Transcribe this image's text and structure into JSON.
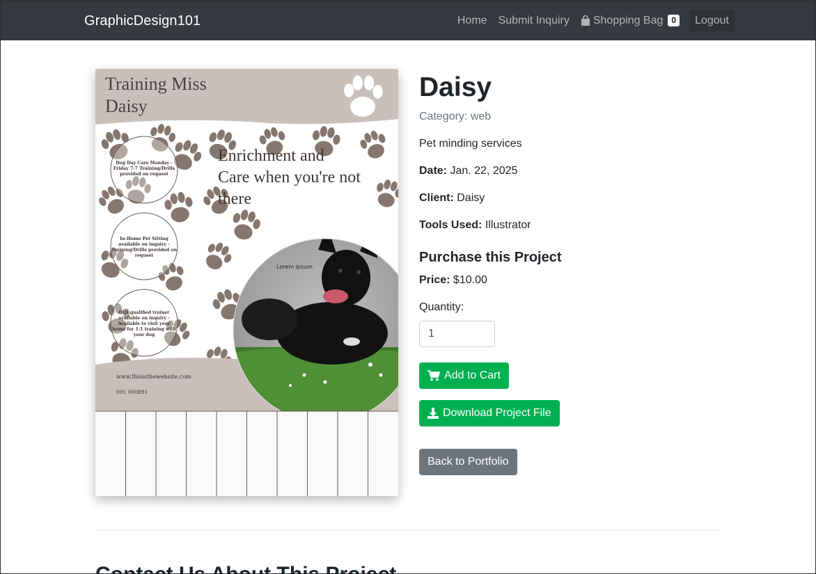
{
  "nav": {
    "brand": "GraphicDesign101",
    "links": {
      "home": "Home",
      "inquiry": "Submit Inquiry",
      "bag": "Shopping Bag",
      "bag_count": "0",
      "logout": "Logout"
    }
  },
  "poster": {
    "title_line1": "Training Miss",
    "title_line2": "Daisy",
    "headline_line1": "Enrichment and",
    "headline_line2": "Care when you're not",
    "headline_line3": "there",
    "circle1": [
      "Dog Day Care Monday -",
      "Friday 7-7 Training/Drills",
      "provided on request"
    ],
    "circle2": [
      "In-Home Pet Sitting",
      "available on inquiry -",
      "Training/Drills provided on",
      "request"
    ],
    "circle3": [
      "QQI qualified trainer",
      "available on inquiry -",
      "Available to visit your",
      "home for 1:1 training with",
      "your dog"
    ],
    "lorem": "Lorem ipsum",
    "website": "www.thisisthewebsite.com",
    "phone": "091 000891",
    "colors": {
      "band": "#c9bfbb",
      "paw": "#85766f"
    }
  },
  "project": {
    "title": "Daisy",
    "category": "Category: web",
    "description": "Pet minding services",
    "date_label": "Date:",
    "date": "Jan. 22, 2025",
    "client_label": "Client:",
    "client": "Daisy",
    "tools_label": "Tools Used:",
    "tools": "Illustrator"
  },
  "purchase": {
    "heading": "Purchase this Project",
    "price_label": "Price:",
    "price": "$10.00",
    "quantity_label": "Quantity:",
    "quantity_value": "1",
    "add_to_cart": "Add to Cart",
    "download": "Download Project File",
    "back": "Back to Portfolio"
  },
  "contact": {
    "heading": "Contact Us About This Project"
  },
  "colors": {
    "navbar": "#343a40",
    "success": "#00b050",
    "secondary": "#6c757d"
  }
}
